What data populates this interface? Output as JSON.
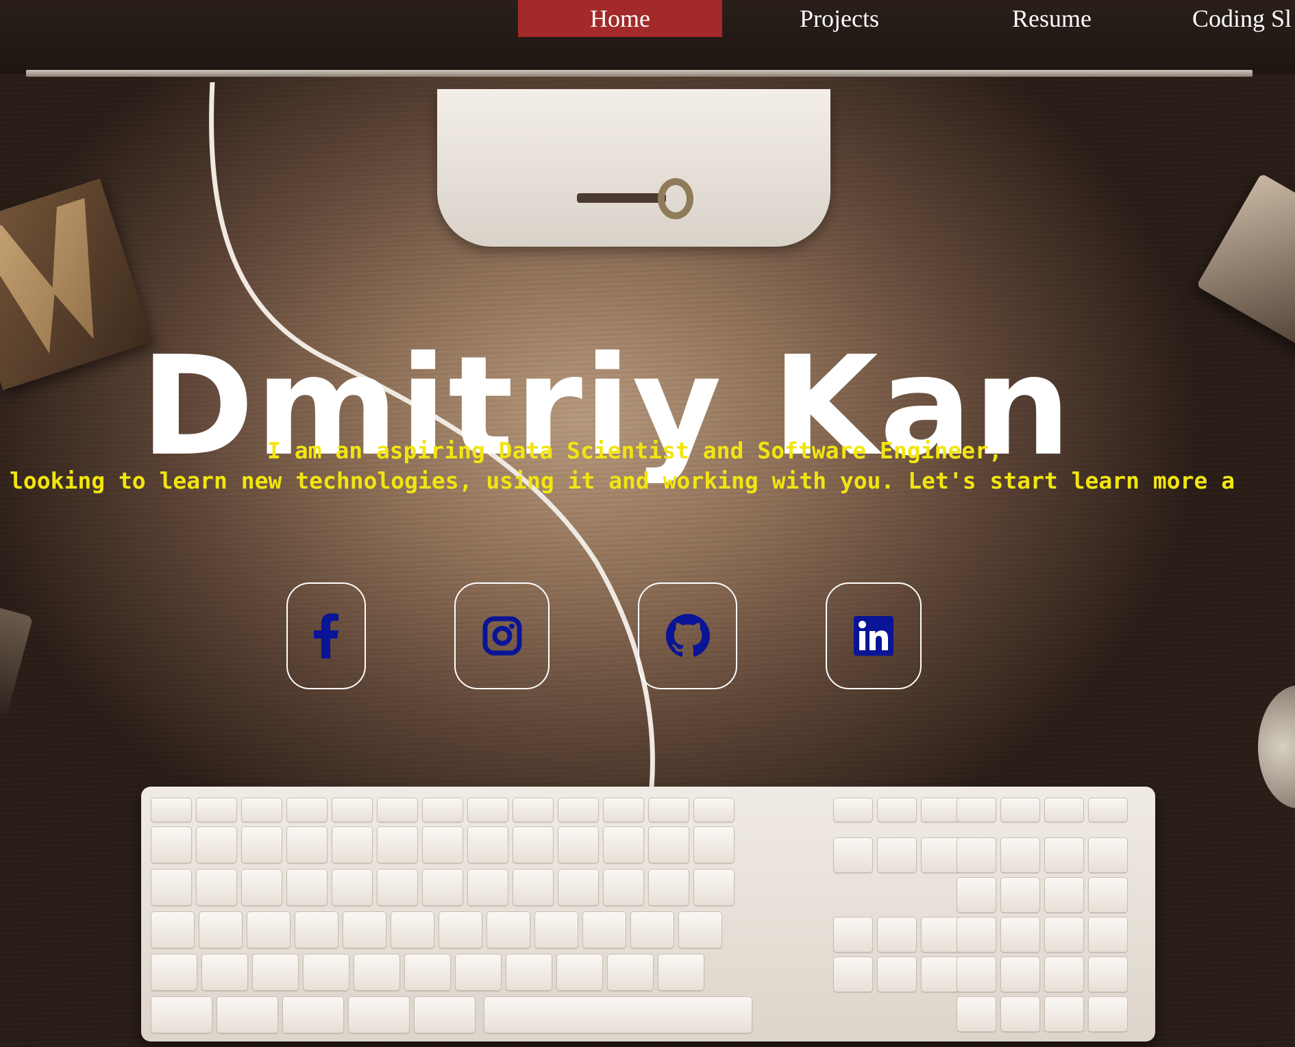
{
  "nav": {
    "items": [
      {
        "label": "Home",
        "active": true
      },
      {
        "label": "Projects",
        "active": false
      },
      {
        "label": "Resume",
        "active": false
      },
      {
        "label": "Coding Sl",
        "active": false
      }
    ],
    "active_color": "#a32a2a"
  },
  "hero": {
    "name": "Dmitriy Kan",
    "tagline_line1": "I am an aspiring Data Scientist and Software Engineer,",
    "tagline_line2": "looking to learn new technologies, using it and working with you. Let's start learn more a",
    "tagline_color": "#f2e511"
  },
  "social": {
    "icon_color": "#0a1496",
    "links": [
      {
        "icon": "facebook-icon"
      },
      {
        "icon": "instagram-icon"
      },
      {
        "icon": "github-icon"
      },
      {
        "icon": "linkedin-icon"
      }
    ]
  }
}
